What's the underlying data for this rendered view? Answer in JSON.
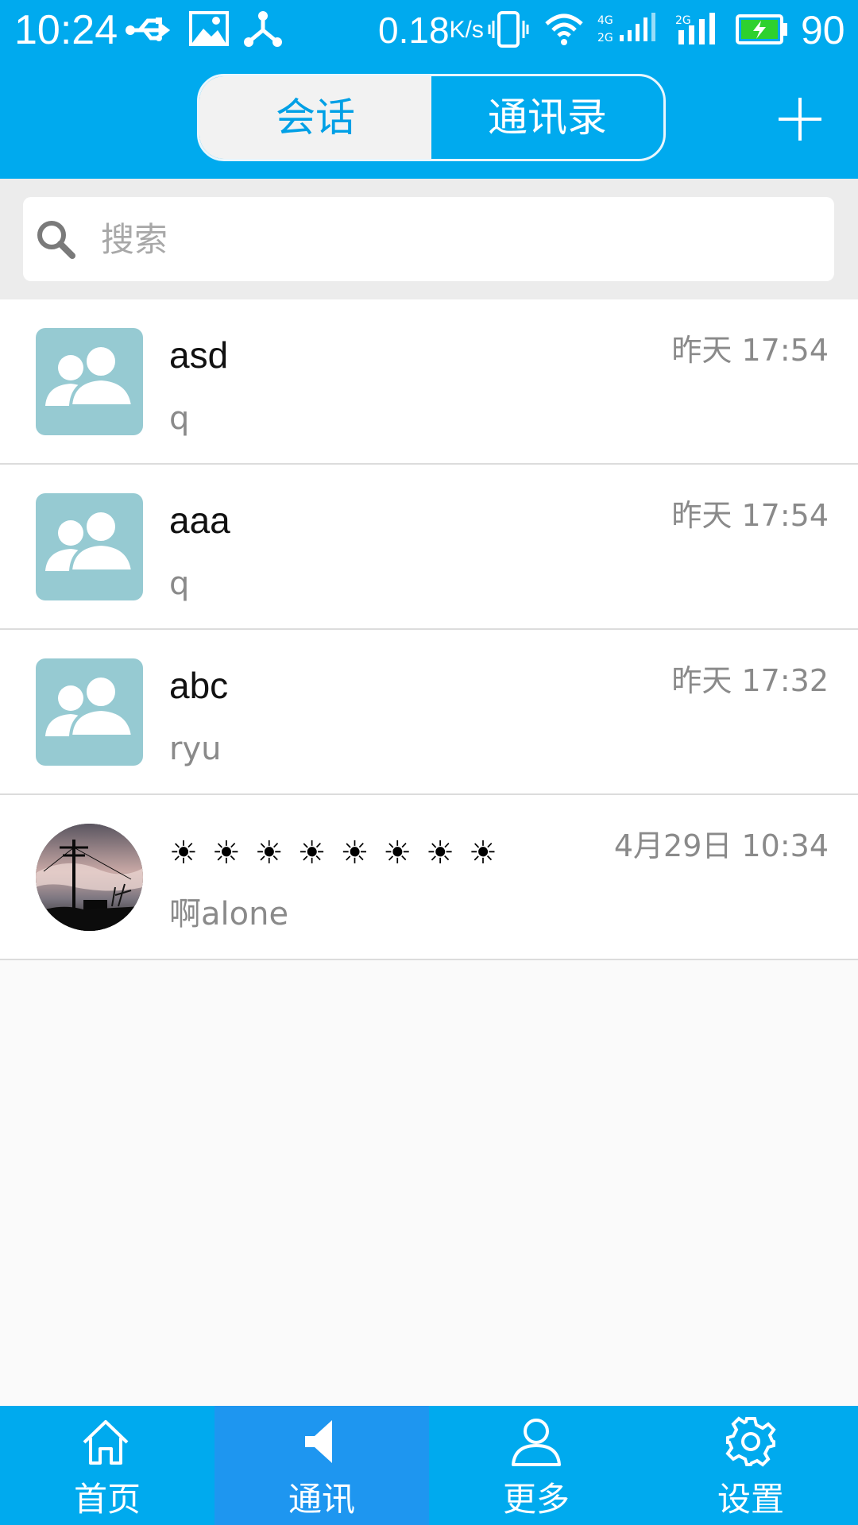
{
  "status_bar": {
    "time": "10:24",
    "speed_value": "0.18",
    "speed_unit": "K/s",
    "battery_level": "90",
    "icons": [
      "usb-icon",
      "image-icon",
      "share-icon",
      "vibrate-icon",
      "wifi-icon",
      "4g-2g-signal-icon",
      "2g-signal-icon",
      "battery-charging-icon"
    ]
  },
  "header": {
    "tabs": [
      {
        "label": "会话",
        "active": true
      },
      {
        "label": "通讯录",
        "active": false
      }
    ],
    "add_icon": "plus-icon",
    "accent_color": "#00aaee"
  },
  "search": {
    "placeholder": "搜索",
    "value": ""
  },
  "conversations": [
    {
      "name": "asd",
      "time": "昨天 17:54",
      "preview": "q",
      "avatar": "group-avatar"
    },
    {
      "name": "aaa",
      "time": "昨天 17:54",
      "preview": "q",
      "avatar": "group-avatar"
    },
    {
      "name": "abc",
      "time": "昨天 17:32",
      "preview": "ryu",
      "avatar": "group-avatar"
    },
    {
      "name": "☀☀☀☀☀☀☀☀",
      "time": "4月29日 10:34",
      "preview": "啊alone",
      "avatar": "photo-avatar"
    }
  ],
  "bottom_nav": [
    {
      "label": "首页",
      "icon": "home-icon",
      "active": false
    },
    {
      "label": "通讯",
      "icon": "speaker-icon",
      "active": true
    },
    {
      "label": "更多",
      "icon": "person-icon",
      "active": false
    },
    {
      "label": "设置",
      "icon": "gear-icon",
      "active": false
    }
  ]
}
